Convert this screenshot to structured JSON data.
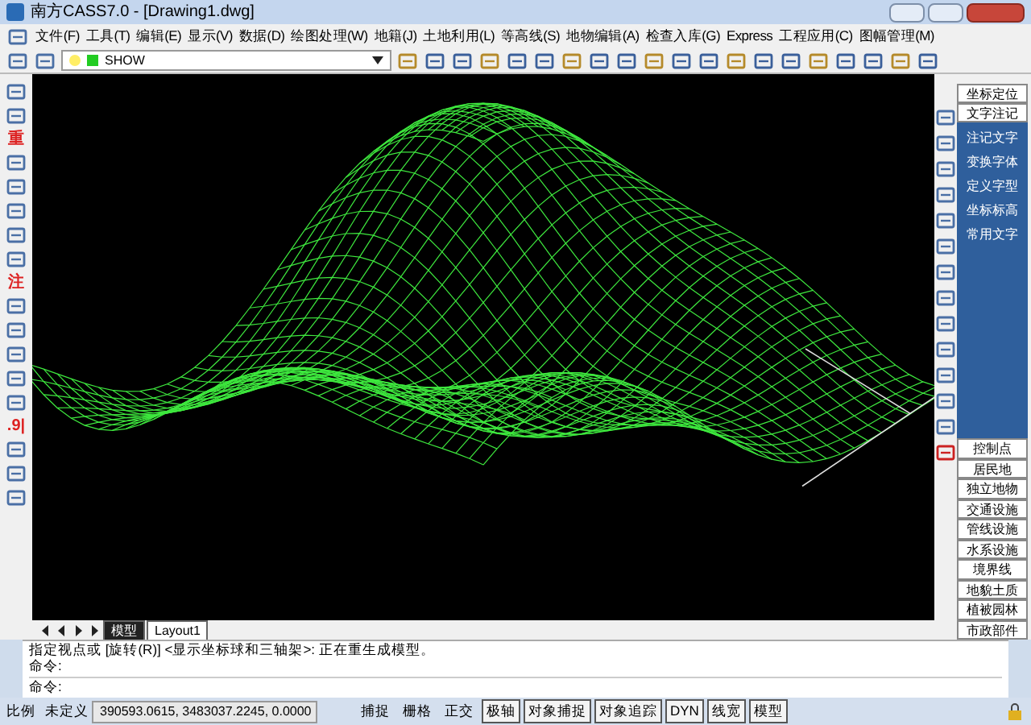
{
  "window": {
    "title": "南方CASS7.0 - [Drawing1.dwg]"
  },
  "menu": [
    "文件(F)",
    "工具(T)",
    "编辑(E)",
    "显示(V)",
    "数据(D)",
    "绘图处理(W)",
    "地籍(J)",
    "土地利用(L)",
    "等高线(S)",
    "地物编辑(A)",
    "检查入库(G)",
    "Express",
    "工程应用(C)",
    "图幅管理(M)"
  ],
  "layer_dropdown": {
    "value": "SHOW"
  },
  "left_tools": [
    {
      "kind": "icon"
    },
    {
      "kind": "icon"
    },
    {
      "kind": "glyph",
      "text": "重"
    },
    {
      "kind": "icon"
    },
    {
      "kind": "icon"
    },
    {
      "kind": "icon"
    },
    {
      "kind": "icon"
    },
    {
      "kind": "icon"
    },
    {
      "kind": "glyph",
      "text": "注"
    },
    {
      "kind": "icon"
    },
    {
      "kind": "icon"
    },
    {
      "kind": "icon"
    },
    {
      "kind": "icon"
    },
    {
      "kind": "icon"
    },
    {
      "kind": "glyph",
      "text": ".9|"
    },
    {
      "kind": "icon"
    },
    {
      "kind": "icon"
    },
    {
      "kind": "icon"
    }
  ],
  "right_panel": {
    "top_button": "坐标定位",
    "active_tab": "文字注记",
    "items": [
      "注记文字",
      "变换字体",
      "定义字型",
      "坐标标高",
      "常用文字"
    ],
    "buttons": [
      "控制点",
      "居民地",
      "独立地物",
      "交通设施",
      "管线设施",
      "水系设施",
      "境界线",
      "地貌土质",
      "植被园林",
      "市政部件"
    ]
  },
  "layout_tabs": [
    {
      "label": "模型",
      "selected": true
    },
    {
      "label": "Layout1",
      "selected": false
    }
  ],
  "command_history": [
    "指定视点或 [旋转(R)] <显示坐标球和三轴架>: 正在重生成模型。",
    "命令:"
  ],
  "command_prompt": "命令:",
  "status_bar": {
    "scale_label": "比例",
    "scale_value": "未定义",
    "coordinates": "390593.0615, 3483037.2245, 0.0000",
    "toggles": [
      {
        "label": "捕捉",
        "on": false
      },
      {
        "label": "栅格",
        "on": false
      },
      {
        "label": "正交",
        "on": false
      },
      {
        "label": "极轴",
        "on": true
      },
      {
        "label": "对象捕捉",
        "on": true
      },
      {
        "label": "对象追踪",
        "on": true
      },
      {
        "label": "DYN",
        "on": true
      },
      {
        "label": "线宽",
        "on": true
      },
      {
        "label": "模型",
        "on": true
      }
    ]
  }
}
